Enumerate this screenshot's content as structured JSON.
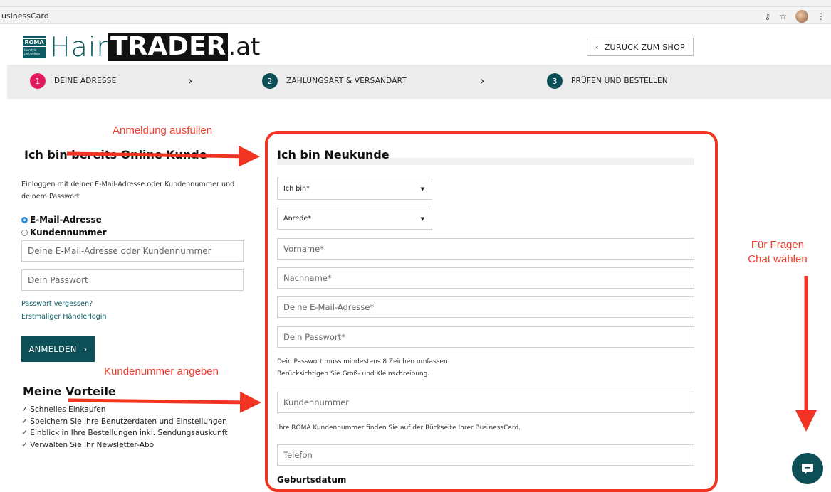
{
  "browser": {
    "tab_title": "usinessCard",
    "key_icon": "key-icon",
    "star_icon": "star-icon",
    "menu_icon": "kebab-menu-icon"
  },
  "logo": {
    "badge_top": "ROMA",
    "badge_bottom": "hairstyle technology",
    "hair": "Hair",
    "trader": "TRADER",
    "at": ".at"
  },
  "header": {
    "back_label": "ZURÜCK ZUM SHOP"
  },
  "steps": [
    {
      "num": "1",
      "label": "DEINE ADRESSE"
    },
    {
      "num": "2",
      "label": "ZAHLUNGSART & VERSANDART"
    },
    {
      "num": "3",
      "label": "PRÜFEN UND BESTELLEN"
    }
  ],
  "login": {
    "title": "Ich bin bereits Online Kunde",
    "description": "Einloggen mit deiner E-Mail-Adresse oder Kundennummer und deinem Passwort",
    "radio_email": "E-Mail-Adresse",
    "radio_customer": "Kundennummer",
    "email_placeholder": "Deine E-Mail-Adresse oder Kundennummer",
    "password_placeholder": "Dein Passwort",
    "forgot_link": "Passwort vergessen?",
    "dealer_link": "Erstmaliger Händlerlogin",
    "submit_label": "ANMELDEN"
  },
  "benefits": {
    "title": "Meine Vorteile",
    "items": [
      "Schnelles Einkaufen",
      "Speichern Sie Ihre Benutzerdaten und Einstellungen",
      "Einblick in Ihre Bestellungen inkl. Sendungsauskunft",
      "Verwalten Sie Ihr Newsletter-Abo"
    ]
  },
  "register": {
    "title": "Ich bin Neukunde",
    "select_type": "Ich bin*",
    "select_salutation": "Anrede*",
    "firstname": "Vorname*",
    "lastname": "Nachname*",
    "email": "Deine E-Mail-Adresse*",
    "password": "Dein Passwort*",
    "password_hint_1": "Dein Passwort muss mindestens 8 Zeichen umfassen.",
    "password_hint_2": "Berücksichtigen Sie Groß- und Kleinschreibung.",
    "customer_number": "Kundennummer",
    "customer_hint": "Ihre ROMA Kundennummer finden Sie auf der Rückseite Ihrer BusinessCard.",
    "phone": "Telefon",
    "birthdate_label": "Geburtsdatum"
  },
  "annotations": {
    "fill_login": "Anmeldung ausfüllen",
    "enter_customer": "Kundenummer angeben",
    "questions_1": "Für Fragen",
    "questions_2": "Chat wählen",
    "color": "#f23522"
  },
  "colors": {
    "brand": "#0c4f57",
    "active_step": "#e31b5c"
  },
  "chat": {
    "icon": "chat-bubble-icon"
  }
}
